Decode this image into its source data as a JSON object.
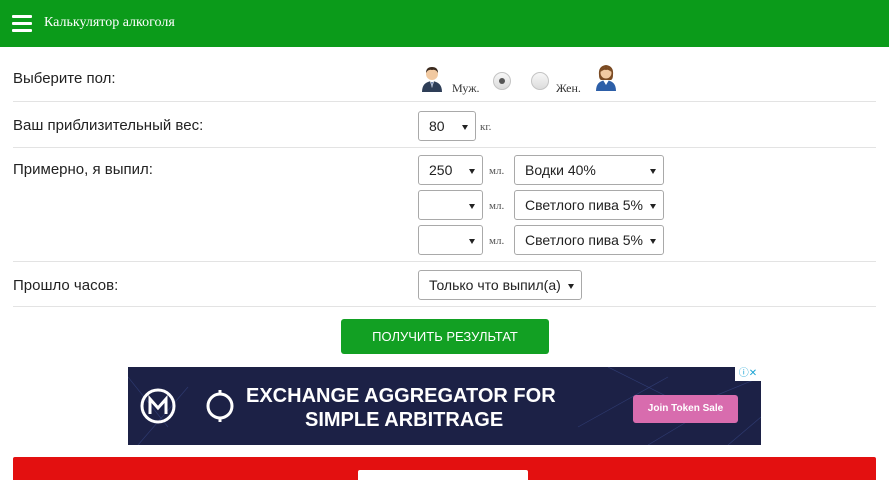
{
  "header": {
    "title": "Калькулятор алкоголя",
    "bg_color": "#0b9b1a"
  },
  "gender": {
    "label": "Выберите пол:",
    "male_label": "Муж.",
    "female_label": "Жен.",
    "selected": "male"
  },
  "weight": {
    "label": "Ваш приблизительный вес:",
    "value": "80",
    "unit": "кг."
  },
  "drinks": {
    "label": "Примерно, я выпил:",
    "rows": [
      {
        "amount": "250",
        "unit": "мл.",
        "type": "Водки 40%"
      },
      {
        "amount": "",
        "unit": "мл.",
        "type": "Светлого пива 5%"
      },
      {
        "amount": "",
        "unit": "мл.",
        "type": "Светлого пива 5%"
      }
    ]
  },
  "hours": {
    "label": "Прошло часов:",
    "value": "Только что выпил(а)"
  },
  "submit": {
    "label": "ПОЛУЧИТЬ РЕЗУЛЬТАТ",
    "color": "#12a023"
  },
  "ad": {
    "line1": "EXCHANGE AGGREGATOR FOR",
    "line2": "SIMPLE ARBITRAGE",
    "cta": "Join Token Sale",
    "badge": "ⓘ✕",
    "bg_color": "#1c2146"
  },
  "result": {
    "bg_color": "#e31010"
  }
}
